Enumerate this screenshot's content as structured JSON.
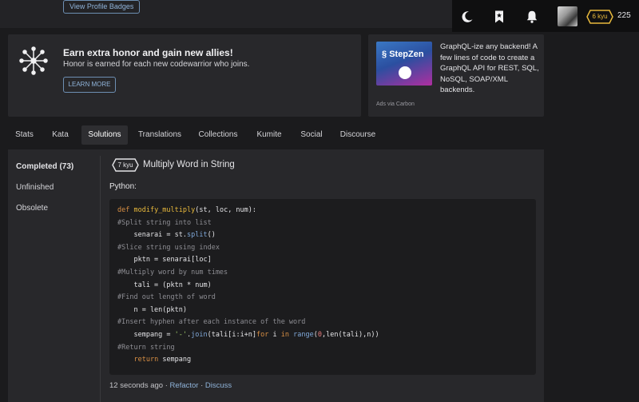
{
  "header": {
    "badges_button": "View Profile Badges",
    "rank": "6 kyu",
    "honor": "225",
    "icons": [
      "moon-icon",
      "bookmark-icon",
      "bell-icon"
    ]
  },
  "promo": {
    "title": "Earn extra honor and gain new allies!",
    "subtitle": "Honor is earned for each new codewarrior who joins.",
    "button": "LEARN MORE"
  },
  "ad": {
    "logo": "StepZen",
    "lines": [
      "GraphQL-ize any backend! A",
      "few lines of code to create a",
      "GraphQL API for REST, SQL,",
      "NoSQL, SOAP/XML",
      "backends."
    ],
    "via": "Ads via Carbon"
  },
  "tabs": [
    "Stats",
    "Kata",
    "Solutions",
    "Translations",
    "Collections",
    "Kumite",
    "Social",
    "Discourse"
  ],
  "active_tab": "Solutions",
  "sidebar": {
    "items": [
      "Completed (73)",
      "Unfinished",
      "Obsolete"
    ]
  },
  "kata": {
    "rank": "7 kyu",
    "title": "Multiply Word in String",
    "language": "Python:"
  },
  "code_lines": [
    "def modify_multiply(st, loc, num):",
    "#Split string into list",
    "    senarai = st.split()",
    "#Slice string using index",
    "    pktn = senarai[loc]",
    "#Multiply word by num times",
    "    tali = (pktn * num)",
    "#Find out length of word",
    "    n = len(pktn)",
    "#Insert hyphen after each instance of the word",
    "    sempang = '-'.join(tali[i:i+n]for i in range(0,len(tali),n))",
    "#Return string",
    "    return sempang"
  ],
  "footer": {
    "time": "12 seconds ago",
    "sep": "·",
    "refactor": "Refactor",
    "discuss": "Discuss"
  },
  "colors": {
    "accent": "#8fb3d9",
    "rank_gold": "#e8b93c",
    "background": "#1b1b1d",
    "panel": "#28282b"
  }
}
